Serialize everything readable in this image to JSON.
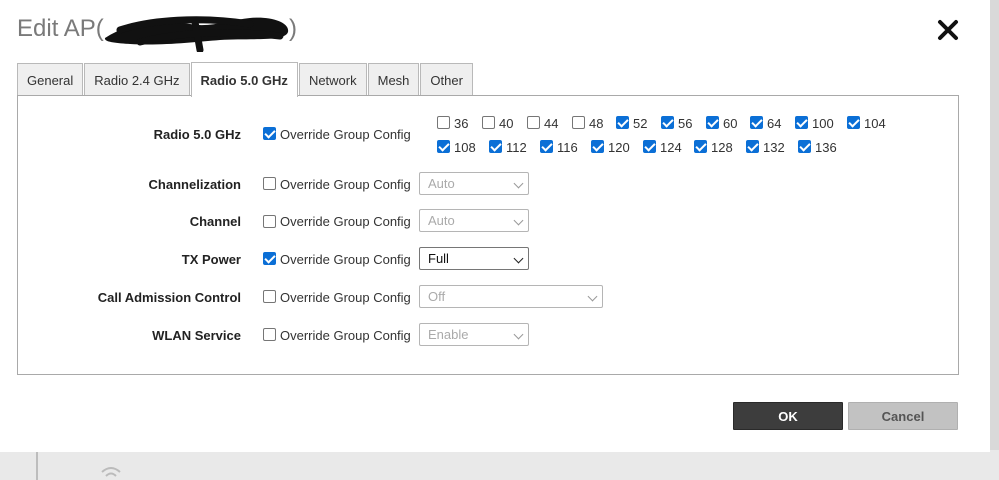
{
  "dialog": {
    "title_prefix": "Edit AP(",
    "title_suffix": ")",
    "close_icon": "close-icon"
  },
  "tabs": [
    {
      "label": "General"
    },
    {
      "label": "Radio 2.4 GHz"
    },
    {
      "label": "Radio 5.0 GHz",
      "active": true
    },
    {
      "label": "Network"
    },
    {
      "label": "Mesh"
    },
    {
      "label": "Other"
    }
  ],
  "override_label": "Override Group Config",
  "rows": {
    "radio": {
      "label": "Radio 5.0 GHz",
      "override": true
    },
    "channelization": {
      "label": "Channelization",
      "override": false,
      "value": "Auto"
    },
    "channel": {
      "label": "Channel",
      "override": false,
      "value": "Auto"
    },
    "tx_power": {
      "label": "TX Power",
      "override": true,
      "value": "Full"
    },
    "cac": {
      "label": "Call Admission Control",
      "override": false,
      "value": "Off"
    },
    "wlan": {
      "label": "WLAN Service",
      "override": false,
      "value": "Enable"
    }
  },
  "channels": [
    {
      "n": "36",
      "checked": false
    },
    {
      "n": "40",
      "checked": false
    },
    {
      "n": "44",
      "checked": false
    },
    {
      "n": "48",
      "checked": false
    },
    {
      "n": "52",
      "checked": true
    },
    {
      "n": "56",
      "checked": true
    },
    {
      "n": "60",
      "checked": true
    },
    {
      "n": "64",
      "checked": true
    },
    {
      "n": "100",
      "checked": true
    },
    {
      "n": "104",
      "checked": true
    },
    {
      "n": "108",
      "checked": true
    },
    {
      "n": "112",
      "checked": true
    },
    {
      "n": "116",
      "checked": true
    },
    {
      "n": "120",
      "checked": true
    },
    {
      "n": "124",
      "checked": true
    },
    {
      "n": "128",
      "checked": true
    },
    {
      "n": "132",
      "checked": true
    },
    {
      "n": "136",
      "checked": true
    }
  ],
  "buttons": {
    "ok": "OK",
    "cancel": "Cancel"
  },
  "colors": {
    "checkbox_accent": "#0b6fd6",
    "ok_bg": "#3d3d3d",
    "cancel_bg": "#c2c2c2"
  }
}
